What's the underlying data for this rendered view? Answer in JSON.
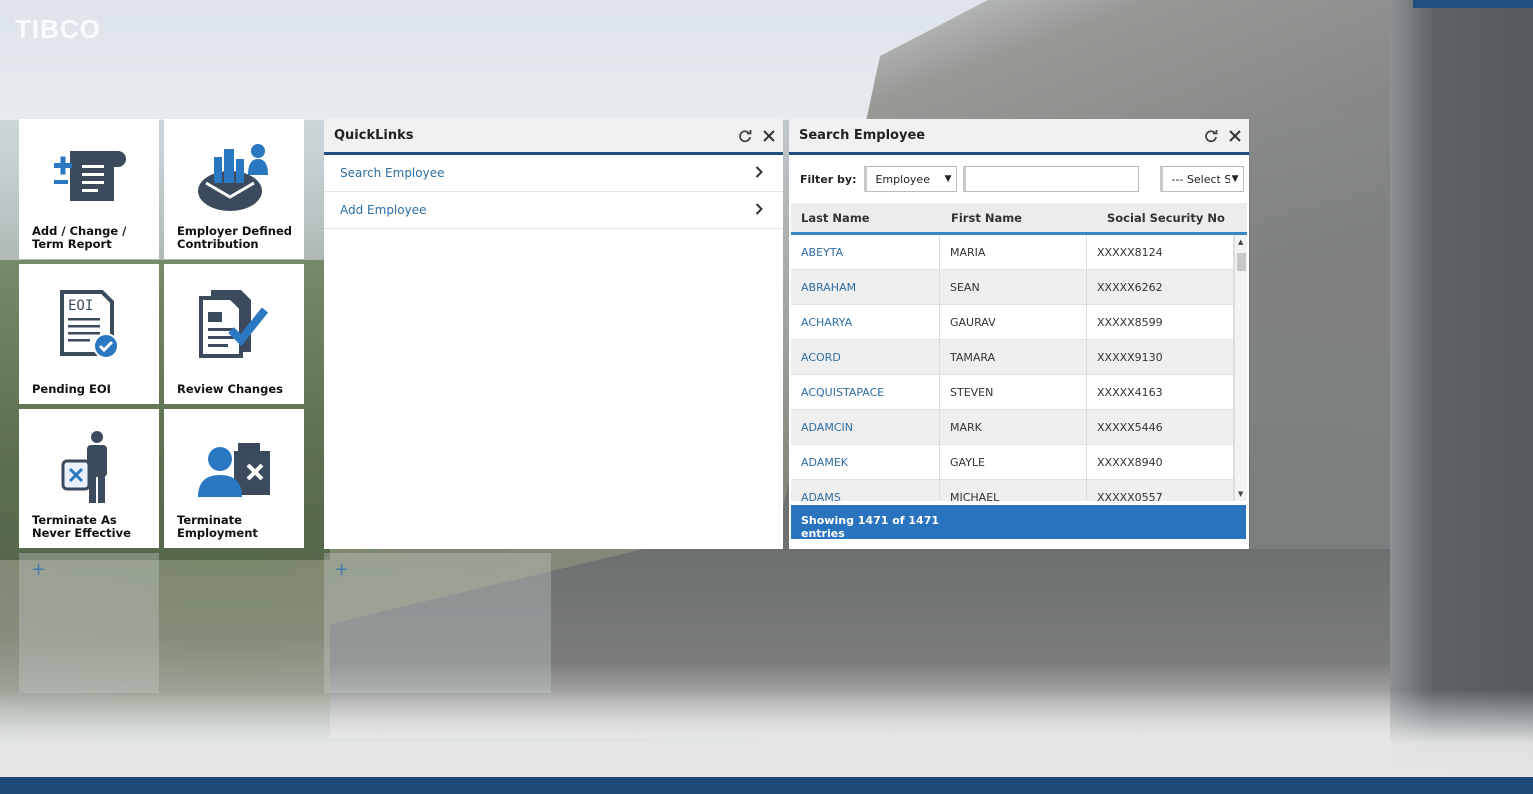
{
  "brand": {
    "logo": "TIBCO"
  },
  "tiles": [
    {
      "label": "Add / Change / Term Report",
      "icon": "document-add-icon"
    },
    {
      "label": "Employer Defined Contribution",
      "icon": "employer-contribution-icon"
    },
    {
      "label": "Pending EOI",
      "icon": "eoi-document-icon",
      "icon_text": "EOI"
    },
    {
      "label": "Review Changes",
      "icon": "review-checklist-icon"
    },
    {
      "label": "Terminate As Never Effective",
      "icon": "terminate-never-effective-icon"
    },
    {
      "label": "Terminate Employment",
      "icon": "terminate-employment-icon"
    }
  ],
  "add_tile": {
    "symbol": "+"
  },
  "quicklinks": {
    "title": "QuickLinks",
    "items": [
      {
        "label": "Search Employee"
      },
      {
        "label": "Add Employee"
      }
    ]
  },
  "search": {
    "title": "Search Employee",
    "filter_label": "Filter by:",
    "filter_value": "Employee",
    "search_value": "",
    "select_value": "--- Select S",
    "columns": [
      "Last Name",
      "First Name",
      "Social Security No"
    ],
    "rows": [
      {
        "last": "ABEYTA",
        "first": "MARIA",
        "ssn": "XXXXX8124"
      },
      {
        "last": "ABRAHAM",
        "first": "SEAN",
        "ssn": "XXXXX6262"
      },
      {
        "last": "ACHARYA",
        "first": "GAURAV",
        "ssn": "XXXXX8599"
      },
      {
        "last": "ACORD",
        "first": "TAMARA",
        "ssn": "XXXXX9130"
      },
      {
        "last": "ACQUISTAPACE",
        "first": "STEVEN",
        "ssn": "XXXXX4163"
      },
      {
        "last": "ADAMCIN",
        "first": "MARK",
        "ssn": "XXXXX5446"
      },
      {
        "last": "ADAMEK",
        "first": "GAYLE",
        "ssn": "XXXXX8940"
      },
      {
        "last": "ADAMS",
        "first": "MICHAEL",
        "ssn": "XXXXX0557"
      }
    ],
    "footer": "Showing 1471 of 1471 entries"
  },
  "colors": {
    "accent": "#1f4f7f",
    "link": "#2e6da4",
    "footer": "#2a73be"
  }
}
